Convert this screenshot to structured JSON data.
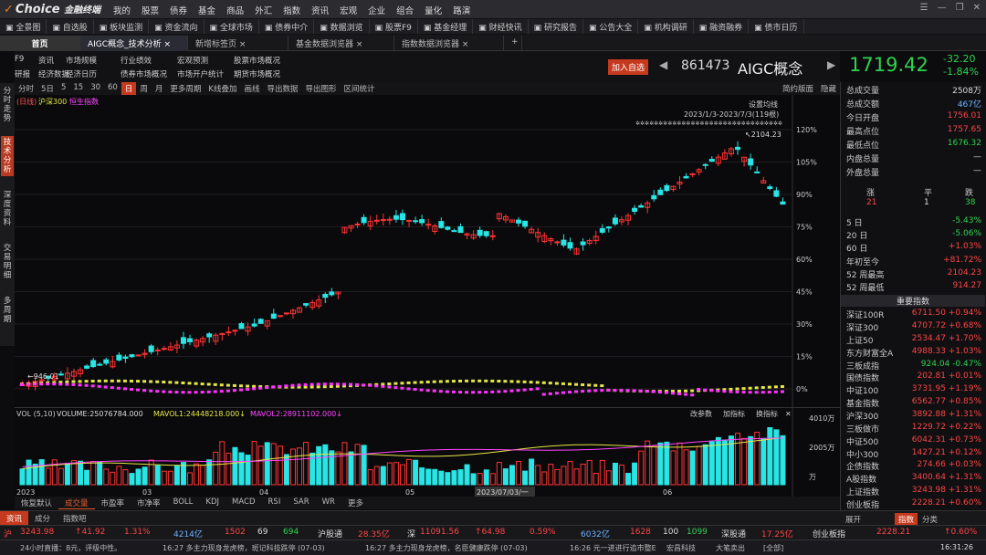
{
  "app": {
    "logo_text": "Choice",
    "logo_sub": "金融终端"
  },
  "menu": [
    "我的",
    "股票",
    "债券",
    "基金",
    "商品",
    "外汇",
    "指数",
    "资讯",
    "宏观",
    "企业",
    "组合",
    "量化",
    "路演"
  ],
  "toolbar": [
    "全景图",
    "自选股",
    "板块监测",
    "资金流向",
    "全球市场",
    "债券中介",
    "数据浏览",
    "股票F9",
    "基金经理",
    "财经快讯",
    "研究报告",
    "公告大全",
    "机构调研",
    "融资融券",
    "债市日历"
  ],
  "tabs": {
    "home": "首页",
    "t1": "AIGC概念_技术分析",
    "t2": "新增标签页",
    "t3": "基金数据浏览器",
    "t4": "指数数据浏览器",
    "plus": "+"
  },
  "sidebar": [
    "分时走势",
    "技术分析",
    "深度资料",
    "交易明细",
    "多周期"
  ],
  "funcbar": {
    "row1": [
      "F9",
      "资讯",
      "市场规模",
      "行业绩效",
      "宏观预测",
      "股票市场概况"
    ],
    "row2": [
      "研报",
      "经济数据",
      "经济日历",
      "债券市场概况",
      "市场开户统计",
      "期货市场概况"
    ]
  },
  "header": {
    "add_btn": "加入自选",
    "code": "861473",
    "name": "AIGC概念",
    "price": "1719.42",
    "chg": "-32.20",
    "pct": "-1.84%"
  },
  "periodbar": [
    "分时",
    "5日",
    "5",
    "15",
    "30",
    "60",
    "日",
    "周",
    "月",
    "更多周期",
    "K线叠加",
    "画线",
    "导出数据",
    "导出图形",
    "区间统计"
  ],
  "periodbar_right": [
    "简约版面",
    "隐藏"
  ],
  "chart_labels": {
    "legend1": "(日线)",
    "legend2": "沪深300",
    "legend3": "恒生指数",
    "setting": "设置均线",
    "range": "2023/1/3-2023/7/3(119根)",
    "high_label": "2104.23",
    "low_label": "946.01"
  },
  "chart_data": {
    "type": "candlestick",
    "yticks": [
      "120%",
      "105%",
      "90%",
      "75%",
      "60%",
      "45%",
      "30%",
      "15%",
      "0%"
    ],
    "xticks": [
      "2023",
      "03",
      "04",
      "05",
      "06"
    ],
    "cursor_date": "2023/07/03/一",
    "vol_title": "VOL (5,10)",
    "volume": "VOLUME:25076784.000",
    "mavol1": "MAVOL1:24448218.000",
    "mavol2": "MAVOL2:28911102.000",
    "vol_yticks": [
      "4010万",
      "2005万",
      "万"
    ],
    "vol_buttons": [
      "改参数",
      "加指标",
      "换指标"
    ]
  },
  "indicator_tabs": [
    "恢复默认",
    "成交量",
    "市盈率",
    "市净率",
    "BOLL",
    "KDJ",
    "MACD",
    "RSI",
    "SAR",
    "WR",
    "更多"
  ],
  "subtabs": [
    "资讯",
    "成分",
    "指数吧"
  ],
  "right": {
    "stats": [
      {
        "k": "总成交量",
        "v": "2508万",
        "c": "wht"
      },
      {
        "k": "总成交额",
        "v": "467亿",
        "c": "blu"
      },
      {
        "k": "今日开盘",
        "v": "1756.01",
        "c": "red"
      },
      {
        "k": "最高点位",
        "v": "1757.65",
        "c": "red"
      },
      {
        "k": "最低点位",
        "v": "1676.32",
        "c": "grn"
      },
      {
        "k": "内盘总量",
        "v": "—",
        "c": "wht"
      },
      {
        "k": "外盘总量",
        "v": "—",
        "c": "wht"
      }
    ],
    "updown": {
      "h1": "涨",
      "h2": "平",
      "h3": "跌",
      "v1": "21",
      "v2": "1",
      "v3": "38"
    },
    "perf": [
      {
        "k": "5 日",
        "v": "-5.43%",
        "c": "grn"
      },
      {
        "k": "20 日",
        "v": "-5.06%",
        "c": "grn"
      },
      {
        "k": "60 日",
        "v": "+1.03%",
        "c": "red"
      },
      {
        "k": "年初至今",
        "v": "+81.72%",
        "c": "red"
      },
      {
        "k": "52 周最高",
        "v": "2104.23",
        "c": "red"
      },
      {
        "k": "52 周最低",
        "v": "914.27",
        "c": "red"
      }
    ],
    "idx_title": "重要指数",
    "indices": [
      {
        "k": "深证100R",
        "v": "6711.50 +0.94%"
      },
      {
        "k": "深证300",
        "v": "4707.72 +0.68%"
      },
      {
        "k": "上证50",
        "v": "2534.47 +1.70%"
      },
      {
        "k": "东方财富全A",
        "v": "4988.33 +1.03%"
      },
      {
        "k": "三板成指",
        "v": "924.04 -0.47%",
        "c": "grn"
      },
      {
        "k": "国债指数",
        "v": "202.81 +0.01%"
      },
      {
        "k": "中证100",
        "v": "3731.95 +1.19%"
      },
      {
        "k": "基金指数",
        "v": "6562.77 +0.85%"
      },
      {
        "k": "沪深300",
        "v": "3892.88 +1.31%"
      },
      {
        "k": "三板做市",
        "v": "1229.72 +0.22%"
      },
      {
        "k": "中证500",
        "v": "6042.31 +0.73%"
      },
      {
        "k": "中小300",
        "v": "1427.21 +0.12%"
      },
      {
        "k": "企债指数",
        "v": "274.66 +0.03%"
      },
      {
        "k": "A股指数",
        "v": "3400.64 +1.31%"
      },
      {
        "k": "上证指数",
        "v": "3243.98 +1.31%"
      },
      {
        "k": "创业板指",
        "v": "2228.21 +0.60%"
      }
    ],
    "tabs": [
      "展开",
      "指数",
      "分类"
    ]
  },
  "ticker": [
    {
      "t": "沪",
      "c": "red"
    },
    {
      "t": "3243.98",
      "c": "red"
    },
    {
      "t": "↑41.92",
      "c": "red"
    },
    {
      "t": "1.31%",
      "c": "red"
    },
    {
      "t": "4214亿",
      "c": "blu"
    },
    {
      "t": "1502",
      "c": "red"
    },
    {
      "t": "69",
      "c": "wht"
    },
    {
      "t": "694",
      "c": "grn"
    },
    {
      "t": "沪股通",
      "c": "wht"
    },
    {
      "t": "28.35亿",
      "c": "red"
    },
    {
      "t": "深",
      "c": "wht"
    },
    {
      "t": "11091.56",
      "c": "red"
    },
    {
      "t": "↑64.98",
      "c": "red"
    },
    {
      "t": "0.59%",
      "c": "red"
    },
    {
      "t": "6032亿",
      "c": "blu"
    },
    {
      "t": "1628",
      "c": "red"
    },
    {
      "t": "100",
      "c": "wht"
    },
    {
      "t": "1099",
      "c": "grn"
    },
    {
      "t": "深股通",
      "c": "wht"
    },
    {
      "t": "17.25亿",
      "c": "red"
    },
    {
      "t": "创业板指",
      "c": "wht"
    },
    {
      "t": "2228.21",
      "c": "red"
    },
    {
      "t": "↑0.60%",
      "c": "red"
    }
  ],
  "status": [
    "24小时直播：8元，评级中性。",
    "16:27 多主力现身龙虎榜，斑记科技跌停 (07-03)",
    "16:27 多主力现身龙虎榜，名臣健康跌停 (07-03)",
    "16:26 元一进进行追市整E",
    "宏昌科技",
    "大笔卖出",
    "[全部]",
    "16:31:26"
  ]
}
